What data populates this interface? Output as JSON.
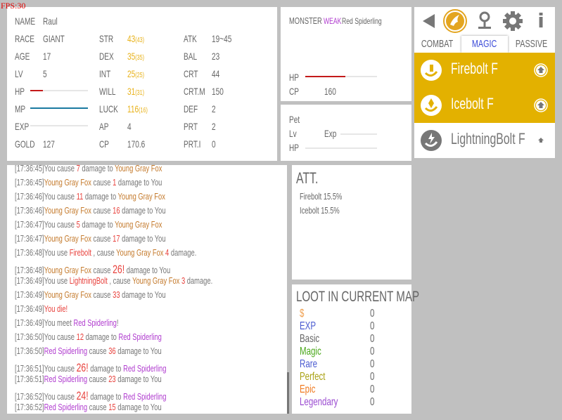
{
  "fps": "FPS:30",
  "character": {
    "col1": [
      {
        "label": "NAME",
        "value": "Raul"
      },
      {
        "label": "RACE",
        "value": "GIANT"
      },
      {
        "label": "AGE",
        "value": "17"
      },
      {
        "label": "LV",
        "value": "5"
      }
    ],
    "bars": [
      {
        "label": "HP",
        "fraction": 0.22,
        "color": "#c41a1a"
      },
      {
        "label": "MP",
        "fraction": 1.0,
        "color": "#1a7aa0"
      },
      {
        "label": "EXP",
        "fraction": 0.0,
        "color": "#888888"
      }
    ],
    "gold": {
      "label": "GOLD",
      "value": "127"
    },
    "col2": [
      {
        "label": "STR",
        "value": "43",
        "base": "(43)"
      },
      {
        "label": "DEX",
        "value": "35",
        "base": "(35)"
      },
      {
        "label": "INT",
        "value": "25",
        "base": "(25)"
      },
      {
        "label": "WILL",
        "value": "31",
        "base": "(31)"
      },
      {
        "label": "LUCK",
        "value": "116",
        "base": "(16)"
      },
      {
        "label": "AP",
        "value": "4",
        "base": ""
      },
      {
        "label": "CP",
        "value": "170.6",
        "base": ""
      }
    ],
    "col3": [
      {
        "label": "ATK",
        "value": "19~45"
      },
      {
        "label": "BAL",
        "value": "23"
      },
      {
        "label": "CRT",
        "value": "44"
      },
      {
        "label": "CRT.M",
        "value": "150"
      },
      {
        "label": "DEF",
        "value": "2"
      },
      {
        "label": "PRT",
        "value": "2"
      },
      {
        "label": "PRT.I",
        "value": "0"
      }
    ]
  },
  "monster": {
    "label": "MONSTER",
    "tag": "WEAK",
    "name": "Red Spiderling",
    "hp_label": "HP",
    "hp_fraction": 0.56,
    "cp_label": "CP",
    "cp_value": "160"
  },
  "pet": {
    "title": "Pet",
    "lv_label": "Lv",
    "exp_label": "Exp",
    "hp_label": "HP"
  },
  "skills_panel": {
    "icons": [
      "back-arrow-icon",
      "magic-skill-icon",
      "map-pin-icon",
      "gear-icon",
      "info-icon"
    ],
    "info_glyph": "i",
    "tabs": [
      {
        "label": "COMBAT",
        "active": false
      },
      {
        "label": "MAGIC",
        "active": true
      },
      {
        "label": "PASSIVE",
        "active": false
      }
    ],
    "skills": [
      {
        "name": "Firebolt F",
        "highlighted": true
      },
      {
        "name": "Icebolt F",
        "highlighted": true
      },
      {
        "name": "LightningBolt F",
        "highlighted": false
      }
    ]
  },
  "log": [
    [
      {
        "t": "[17:36:45]You cause "
      },
      {
        "t": "7",
        "c": "red"
      },
      {
        "t": " damage to "
      },
      {
        "t": "Young Gray Fox",
        "c": "or"
      }
    ],
    [
      {
        "t": "[17:36:45]"
      },
      {
        "t": "Young Gray Fox",
        "c": "or"
      },
      {
        "t": " cause "
      },
      {
        "t": "1",
        "c": "red"
      },
      {
        "t": " damage to You"
      }
    ],
    [
      {
        "t": "[17:36:46]You cause "
      },
      {
        "t": "11",
        "c": "red"
      },
      {
        "t": " damage to "
      },
      {
        "t": "Young Gray Fox",
        "c": "or"
      }
    ],
    [
      {
        "t": "[17:36:46]"
      },
      {
        "t": "Young Gray Fox",
        "c": "or"
      },
      {
        "t": " cause "
      },
      {
        "t": "16",
        "c": "red"
      },
      {
        "t": " damage to You"
      }
    ],
    [
      {
        "t": "[17:36:47]You cause "
      },
      {
        "t": "5",
        "c": "red"
      },
      {
        "t": " damage to "
      },
      {
        "t": "Young Gray Fox",
        "c": "or"
      }
    ],
    [
      {
        "t": "[17:36:47]"
      },
      {
        "t": "Young Gray Fox",
        "c": "or"
      },
      {
        "t": " cause "
      },
      {
        "t": "17",
        "c": "red"
      },
      {
        "t": " damage to You"
      }
    ],
    [
      {
        "t": "[17:36:48]You use "
      },
      {
        "t": "Firebolt",
        "c": "red"
      },
      {
        "t": "  , cause "
      },
      {
        "t": "Young Gray Fox",
        "c": "or"
      },
      {
        "t": " 4",
        "c": "red"
      },
      {
        "t": " damage."
      }
    ],
    [
      {
        "t": "[17:36:48]"
      },
      {
        "t": "Young Gray Fox",
        "c": "or"
      },
      {
        "t": " cause "
      },
      {
        "t": "26!",
        "c": "red",
        "big": true
      },
      {
        "t": " damage to You"
      }
    ],
    [
      {
        "t": "[17:36:49]You use "
      },
      {
        "t": "LightningBolt",
        "c": "red"
      },
      {
        "t": "  , cause "
      },
      {
        "t": "Young Gray Fox",
        "c": "or"
      },
      {
        "t": " 3",
        "c": "red"
      },
      {
        "t": " damage."
      }
    ],
    [
      {
        "t": "[17:36:49]"
      },
      {
        "t": "Young Gray Fox",
        "c": "or"
      },
      {
        "t": " cause "
      },
      {
        "t": "33",
        "c": "red"
      },
      {
        "t": " damage to You"
      }
    ],
    [
      {
        "t": "[17:36:49]"
      },
      {
        "t": "You die!",
        "c": "red"
      }
    ],
    [
      {
        "t": "[17:36:49]You meet "
      },
      {
        "t": "Red Spiderling",
        "c": "pur"
      },
      {
        "t": "!"
      }
    ],
    [
      {
        "t": "[17:36:50]You cause "
      },
      {
        "t": "12",
        "c": "red"
      },
      {
        "t": " damage to "
      },
      {
        "t": "Red Spiderling",
        "c": "pur"
      }
    ],
    [
      {
        "t": "[17:36:50]"
      },
      {
        "t": "Red Spiderling",
        "c": "pur"
      },
      {
        "t": " cause "
      },
      {
        "t": "36",
        "c": "red"
      },
      {
        "t": " damage to You"
      }
    ],
    [
      {
        "t": "[17:36:51]You cause "
      },
      {
        "t": "26!",
        "c": "red",
        "big": true
      },
      {
        "t": " damage to "
      },
      {
        "t": "Red Spiderling",
        "c": "pur"
      }
    ],
    [
      {
        "t": "[17:36:51]"
      },
      {
        "t": "Red Spiderling",
        "c": "pur"
      },
      {
        "t": " cause "
      },
      {
        "t": "23",
        "c": "red"
      },
      {
        "t": " damage to You"
      }
    ],
    [
      {
        "t": "[17:36:52]You cause "
      },
      {
        "t": "24!",
        "c": "red",
        "big": true
      },
      {
        "t": " damage to "
      },
      {
        "t": "Red Spiderling",
        "c": "pur"
      }
    ],
    [
      {
        "t": "[17:36:52]"
      },
      {
        "t": "Red Spiderling",
        "c": "pur"
      },
      {
        "t": " cause "
      },
      {
        "t": "15",
        "c": "red"
      },
      {
        "t": " damage to You"
      }
    ]
  ],
  "att": {
    "title": "ATT.",
    "items": [
      {
        "name": "Firebolt",
        "value": "15.5%"
      },
      {
        "name": "Icebolt",
        "value": "15.5%"
      }
    ]
  },
  "loot": {
    "title": "LOOT IN CURRENT MAP",
    "items": [
      {
        "label": "$",
        "value": "0",
        "color": "#f0a050"
      },
      {
        "label": "EXP",
        "value": "0",
        "color": "#4a5ad0"
      },
      {
        "label": "Basic",
        "value": "0",
        "color": "#666666"
      },
      {
        "label": "Magic",
        "value": "0",
        "color": "#4aa81a"
      },
      {
        "label": "Rare",
        "value": "0",
        "color": "#4a5ad0"
      },
      {
        "label": "Perfect",
        "value": "0",
        "color": "#a8a010"
      },
      {
        "label": "Epic",
        "value": "0",
        "color": "#f07a20"
      },
      {
        "label": "Legendary",
        "value": "0",
        "color": "#9a4ad0"
      }
    ]
  },
  "colors": {
    "skill_highlight": "#e3b100",
    "tab_active": "#3a4ad8",
    "icon_gray": "#777777"
  }
}
